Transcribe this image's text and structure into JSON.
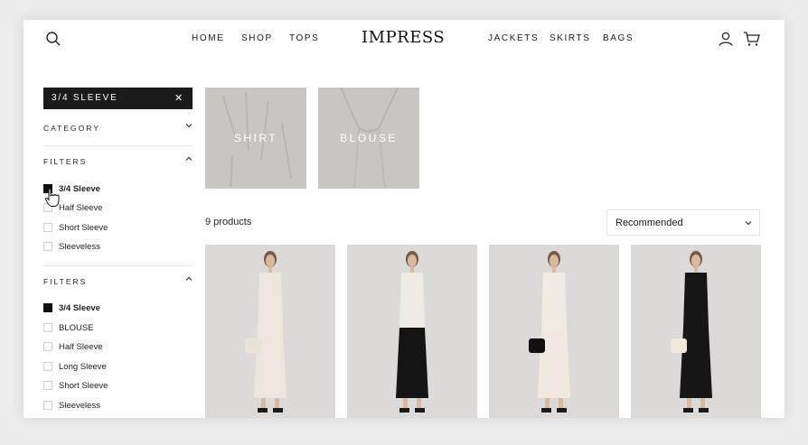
{
  "header": {
    "logo": "IMPRESS",
    "nav_left": [
      "HOME",
      "SHOP",
      "TOPS"
    ],
    "nav_right": [
      "JACKETS",
      "SKIRTS",
      "BAGS"
    ]
  },
  "sidebar": {
    "active_filter": "3/4 SLEEVE",
    "sections": [
      {
        "title": "CATEGORY"
      },
      {
        "title": "FILTERS",
        "options": [
          {
            "label": "3/4 Sleeve",
            "checked": true
          },
          {
            "label": "Half Sleeve",
            "checked": false
          },
          {
            "label": "Short Sleeve",
            "checked": false
          },
          {
            "label": "Sleeveless",
            "checked": false
          }
        ]
      },
      {
        "title": "FILTERS",
        "options": [
          {
            "label": "3/4 Sleeve",
            "checked": true
          },
          {
            "label": "BLOUSE",
            "checked": false
          },
          {
            "label": "Half Sleeve",
            "checked": false
          },
          {
            "label": "Long Sleeve",
            "checked": false
          },
          {
            "label": "Short Sleeve",
            "checked": false
          },
          {
            "label": "Sleeveless",
            "checked": false
          }
        ]
      }
    ]
  },
  "categories": [
    {
      "label": "SHIRT"
    },
    {
      "label": "BLOUSE"
    }
  ],
  "results": {
    "count_text": "9 products",
    "sort_value": "Recommended"
  },
  "products": [
    {
      "top": "#ece6dc",
      "bottom": "#ece6dc",
      "bag": "#e9e2d6"
    },
    {
      "top": "#efebe4",
      "bottom": "#141414",
      "bag": ""
    },
    {
      "top": "#f1ece3",
      "bottom": "#efe9df",
      "bag": "#111111"
    },
    {
      "top": "#161616",
      "bottom": "#161616",
      "bag": "#efe8dc"
    }
  ]
}
